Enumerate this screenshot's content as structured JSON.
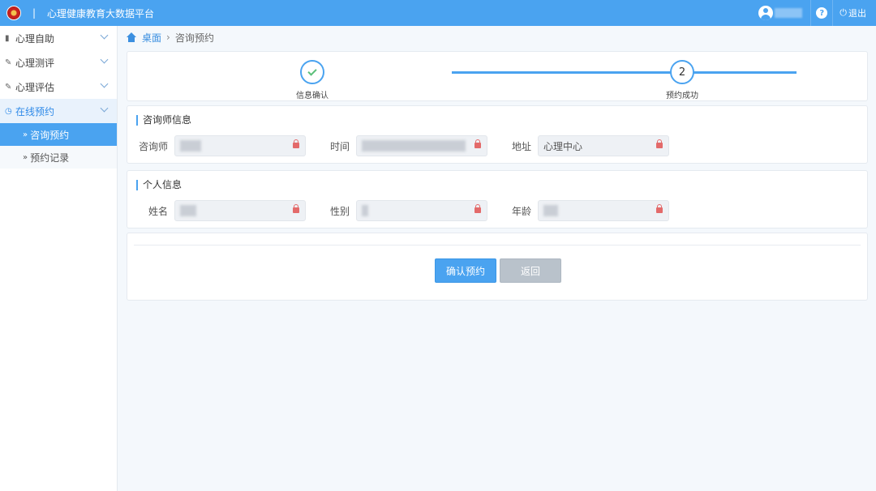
{
  "header": {
    "separator": "|",
    "title": "心理健康教育大数据平台",
    "help_label": "?",
    "logout_label": "退出"
  },
  "sidebar": {
    "items": [
      {
        "label": "心理自助",
        "icon": "book-icon"
      },
      {
        "label": "心理测评",
        "icon": "edit-icon"
      },
      {
        "label": "心理评估",
        "icon": "edit-icon"
      },
      {
        "label": "在线预约",
        "icon": "clock-icon"
      }
    ],
    "subitems": [
      {
        "label": "咨询预约"
      },
      {
        "label": "预约记录"
      }
    ]
  },
  "breadcrumb": {
    "home": "桌面",
    "current": "咨询预约"
  },
  "steps": [
    {
      "label": "信息确认",
      "status": "done"
    },
    {
      "number": "2",
      "label": "预约成功",
      "status": "current"
    }
  ],
  "counselor_section": {
    "title": "咨询师信息",
    "fields": [
      {
        "label": "咨询师",
        "value": ""
      },
      {
        "label": "时间",
        "value": ""
      },
      {
        "label": "地址",
        "value": "心理中心"
      }
    ]
  },
  "personal_section": {
    "title": "个人信息",
    "fields": [
      {
        "label": "姓名",
        "value": ""
      },
      {
        "label": "性别",
        "value": ""
      },
      {
        "label": "年龄",
        "value": ""
      }
    ]
  },
  "actions": {
    "confirm_label": "确认预约",
    "back_label": "返回"
  },
  "colors": {
    "primary": "#4aa3f0",
    "success": "#5cbf7a",
    "lock": "#e36a6a",
    "disabled": "#b9c2cb"
  }
}
